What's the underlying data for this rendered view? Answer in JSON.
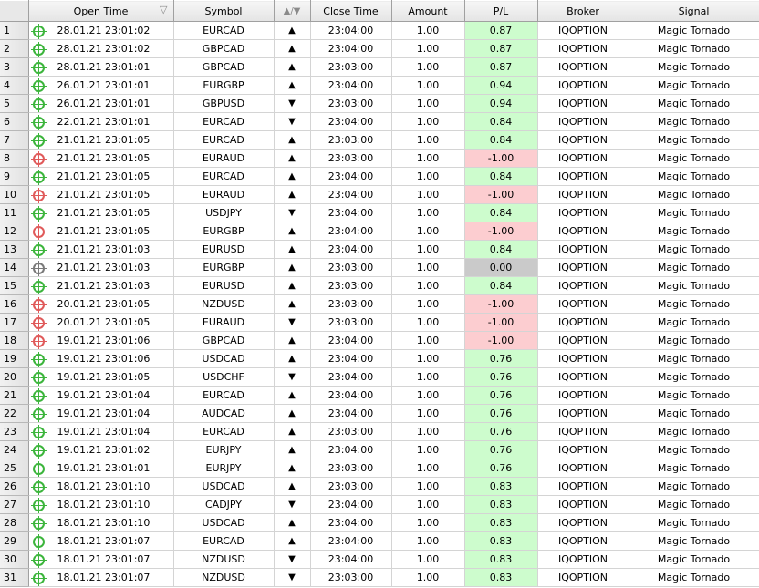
{
  "columns": {
    "open_time": "Open Time",
    "open_time_sort": "▽",
    "symbol": "Symbol",
    "direction": "▲/▼",
    "close_time": "Close Time",
    "amount": "Amount",
    "pl": "P/L",
    "broker": "Broker",
    "signal": "Signal"
  },
  "colors": {
    "win_icon": "#3cb53c",
    "loss_icon": "#e05a5a",
    "draw_icon": "#7a7a7a",
    "pl_positive_bg": "#cdfccd",
    "pl_negative_bg": "#fccdd0",
    "pl_zero_bg": "#cacaca"
  },
  "rows": [
    {
      "n": "1",
      "status": "win",
      "open_time": "28.01.21 23:01:02",
      "symbol": "EURCAD",
      "dir": "▲",
      "close_time": "23:04:00",
      "amount": "1.00",
      "pl": "0.87",
      "broker": "IQOPTION",
      "signal": "Magic Tornado"
    },
    {
      "n": "2",
      "status": "win",
      "open_time": "28.01.21 23:01:02",
      "symbol": "GBPCAD",
      "dir": "▲",
      "close_time": "23:04:00",
      "amount": "1.00",
      "pl": "0.87",
      "broker": "IQOPTION",
      "signal": "Magic Tornado"
    },
    {
      "n": "3",
      "status": "win",
      "open_time": "28.01.21 23:01:01",
      "symbol": "GBPCAD",
      "dir": "▲",
      "close_time": "23:03:00",
      "amount": "1.00",
      "pl": "0.87",
      "broker": "IQOPTION",
      "signal": "Magic Tornado"
    },
    {
      "n": "4",
      "status": "win",
      "open_time": "26.01.21 23:01:01",
      "symbol": "EURGBP",
      "dir": "▲",
      "close_time": "23:04:00",
      "amount": "1.00",
      "pl": "0.94",
      "broker": "IQOPTION",
      "signal": "Magic Tornado"
    },
    {
      "n": "5",
      "status": "win",
      "open_time": "26.01.21 23:01:01",
      "symbol": "GBPUSD",
      "dir": "▼",
      "close_time": "23:03:00",
      "amount": "1.00",
      "pl": "0.94",
      "broker": "IQOPTION",
      "signal": "Magic Tornado"
    },
    {
      "n": "6",
      "status": "win",
      "open_time": "22.01.21 23:01:01",
      "symbol": "EURCAD",
      "dir": "▼",
      "close_time": "23:04:00",
      "amount": "1.00",
      "pl": "0.84",
      "broker": "IQOPTION",
      "signal": "Magic Tornado"
    },
    {
      "n": "7",
      "status": "win",
      "open_time": "21.01.21 23:01:05",
      "symbol": "EURCAD",
      "dir": "▲",
      "close_time": "23:03:00",
      "amount": "1.00",
      "pl": "0.84",
      "broker": "IQOPTION",
      "signal": "Magic Tornado"
    },
    {
      "n": "8",
      "status": "loss",
      "open_time": "21.01.21 23:01:05",
      "symbol": "EURAUD",
      "dir": "▲",
      "close_time": "23:03:00",
      "amount": "1.00",
      "pl": "-1.00",
      "broker": "IQOPTION",
      "signal": "Magic Tornado"
    },
    {
      "n": "9",
      "status": "win",
      "open_time": "21.01.21 23:01:05",
      "symbol": "EURCAD",
      "dir": "▲",
      "close_time": "23:04:00",
      "amount": "1.00",
      "pl": "0.84",
      "broker": "IQOPTION",
      "signal": "Magic Tornado"
    },
    {
      "n": "10",
      "status": "loss",
      "open_time": "21.01.21 23:01:05",
      "symbol": "EURAUD",
      "dir": "▲",
      "close_time": "23:04:00",
      "amount": "1.00",
      "pl": "-1.00",
      "broker": "IQOPTION",
      "signal": "Magic Tornado"
    },
    {
      "n": "11",
      "status": "win",
      "open_time": "21.01.21 23:01:05",
      "symbol": "USDJPY",
      "dir": "▼",
      "close_time": "23:04:00",
      "amount": "1.00",
      "pl": "0.84",
      "broker": "IQOPTION",
      "signal": "Magic Tornado"
    },
    {
      "n": "12",
      "status": "loss",
      "open_time": "21.01.21 23:01:05",
      "symbol": "EURGBP",
      "dir": "▲",
      "close_time": "23:04:00",
      "amount": "1.00",
      "pl": "-1.00",
      "broker": "IQOPTION",
      "signal": "Magic Tornado"
    },
    {
      "n": "13",
      "status": "win",
      "open_time": "21.01.21 23:01:03",
      "symbol": "EURUSD",
      "dir": "▲",
      "close_time": "23:04:00",
      "amount": "1.00",
      "pl": "0.84",
      "broker": "IQOPTION",
      "signal": "Magic Tornado"
    },
    {
      "n": "14",
      "status": "draw",
      "open_time": "21.01.21 23:01:03",
      "symbol": "EURGBP",
      "dir": "▲",
      "close_time": "23:03:00",
      "amount": "1.00",
      "pl": "0.00",
      "broker": "IQOPTION",
      "signal": "Magic Tornado"
    },
    {
      "n": "15",
      "status": "win",
      "open_time": "21.01.21 23:01:03",
      "symbol": "EURUSD",
      "dir": "▲",
      "close_time": "23:03:00",
      "amount": "1.00",
      "pl": "0.84",
      "broker": "IQOPTION",
      "signal": "Magic Tornado"
    },
    {
      "n": "16",
      "status": "loss",
      "open_time": "20.01.21 23:01:05",
      "symbol": "NZDUSD",
      "dir": "▲",
      "close_time": "23:03:00",
      "amount": "1.00",
      "pl": "-1.00",
      "broker": "IQOPTION",
      "signal": "Magic Tornado"
    },
    {
      "n": "17",
      "status": "loss",
      "open_time": "20.01.21 23:01:05",
      "symbol": "EURAUD",
      "dir": "▼",
      "close_time": "23:03:00",
      "amount": "1.00",
      "pl": "-1.00",
      "broker": "IQOPTION",
      "signal": "Magic Tornado"
    },
    {
      "n": "18",
      "status": "loss",
      "open_time": "19.01.21 23:01:06",
      "symbol": "GBPCAD",
      "dir": "▲",
      "close_time": "23:04:00",
      "amount": "1.00",
      "pl": "-1.00",
      "broker": "IQOPTION",
      "signal": "Magic Tornado"
    },
    {
      "n": "19",
      "status": "win",
      "open_time": "19.01.21 23:01:06",
      "symbol": "USDCAD",
      "dir": "▲",
      "close_time": "23:04:00",
      "amount": "1.00",
      "pl": "0.76",
      "broker": "IQOPTION",
      "signal": "Magic Tornado"
    },
    {
      "n": "20",
      "status": "win",
      "open_time": "19.01.21 23:01:05",
      "symbol": "USDCHF",
      "dir": "▼",
      "close_time": "23:04:00",
      "amount": "1.00",
      "pl": "0.76",
      "broker": "IQOPTION",
      "signal": "Magic Tornado"
    },
    {
      "n": "21",
      "status": "win",
      "open_time": "19.01.21 23:01:04",
      "symbol": "EURCAD",
      "dir": "▲",
      "close_time": "23:04:00",
      "amount": "1.00",
      "pl": "0.76",
      "broker": "IQOPTION",
      "signal": "Magic Tornado"
    },
    {
      "n": "22",
      "status": "win",
      "open_time": "19.01.21 23:01:04",
      "symbol": "AUDCAD",
      "dir": "▲",
      "close_time": "23:04:00",
      "amount": "1.00",
      "pl": "0.76",
      "broker": "IQOPTION",
      "signal": "Magic Tornado"
    },
    {
      "n": "23",
      "status": "win",
      "open_time": "19.01.21 23:01:04",
      "symbol": "EURCAD",
      "dir": "▲",
      "close_time": "23:03:00",
      "amount": "1.00",
      "pl": "0.76",
      "broker": "IQOPTION",
      "signal": "Magic Tornado"
    },
    {
      "n": "24",
      "status": "win",
      "open_time": "19.01.21 23:01:02",
      "symbol": "EURJPY",
      "dir": "▲",
      "close_time": "23:04:00",
      "amount": "1.00",
      "pl": "0.76",
      "broker": "IQOPTION",
      "signal": "Magic Tornado"
    },
    {
      "n": "25",
      "status": "win",
      "open_time": "19.01.21 23:01:01",
      "symbol": "EURJPY",
      "dir": "▲",
      "close_time": "23:03:00",
      "amount": "1.00",
      "pl": "0.76",
      "broker": "IQOPTION",
      "signal": "Magic Tornado"
    },
    {
      "n": "26",
      "status": "win",
      "open_time": "18.01.21 23:01:10",
      "symbol": "USDCAD",
      "dir": "▲",
      "close_time": "23:03:00",
      "amount": "1.00",
      "pl": "0.83",
      "broker": "IQOPTION",
      "signal": "Magic Tornado"
    },
    {
      "n": "27",
      "status": "win",
      "open_time": "18.01.21 23:01:10",
      "symbol": "CADJPY",
      "dir": "▼",
      "close_time": "23:04:00",
      "amount": "1.00",
      "pl": "0.83",
      "broker": "IQOPTION",
      "signal": "Magic Tornado"
    },
    {
      "n": "28",
      "status": "win",
      "open_time": "18.01.21 23:01:10",
      "symbol": "USDCAD",
      "dir": "▲",
      "close_time": "23:04:00",
      "amount": "1.00",
      "pl": "0.83",
      "broker": "IQOPTION",
      "signal": "Magic Tornado"
    },
    {
      "n": "29",
      "status": "win",
      "open_time": "18.01.21 23:01:07",
      "symbol": "EURCAD",
      "dir": "▲",
      "close_time": "23:04:00",
      "amount": "1.00",
      "pl": "0.83",
      "broker": "IQOPTION",
      "signal": "Magic Tornado"
    },
    {
      "n": "30",
      "status": "win",
      "open_time": "18.01.21 23:01:07",
      "symbol": "NZDUSD",
      "dir": "▼",
      "close_time": "23:04:00",
      "amount": "1.00",
      "pl": "0.83",
      "broker": "IQOPTION",
      "signal": "Magic Tornado"
    },
    {
      "n": "31",
      "status": "win",
      "open_time": "18.01.21 23:01:07",
      "symbol": "NZDUSD",
      "dir": "▼",
      "close_time": "23:03:00",
      "amount": "1.00",
      "pl": "0.83",
      "broker": "IQOPTION",
      "signal": "Magic Tornado"
    }
  ]
}
